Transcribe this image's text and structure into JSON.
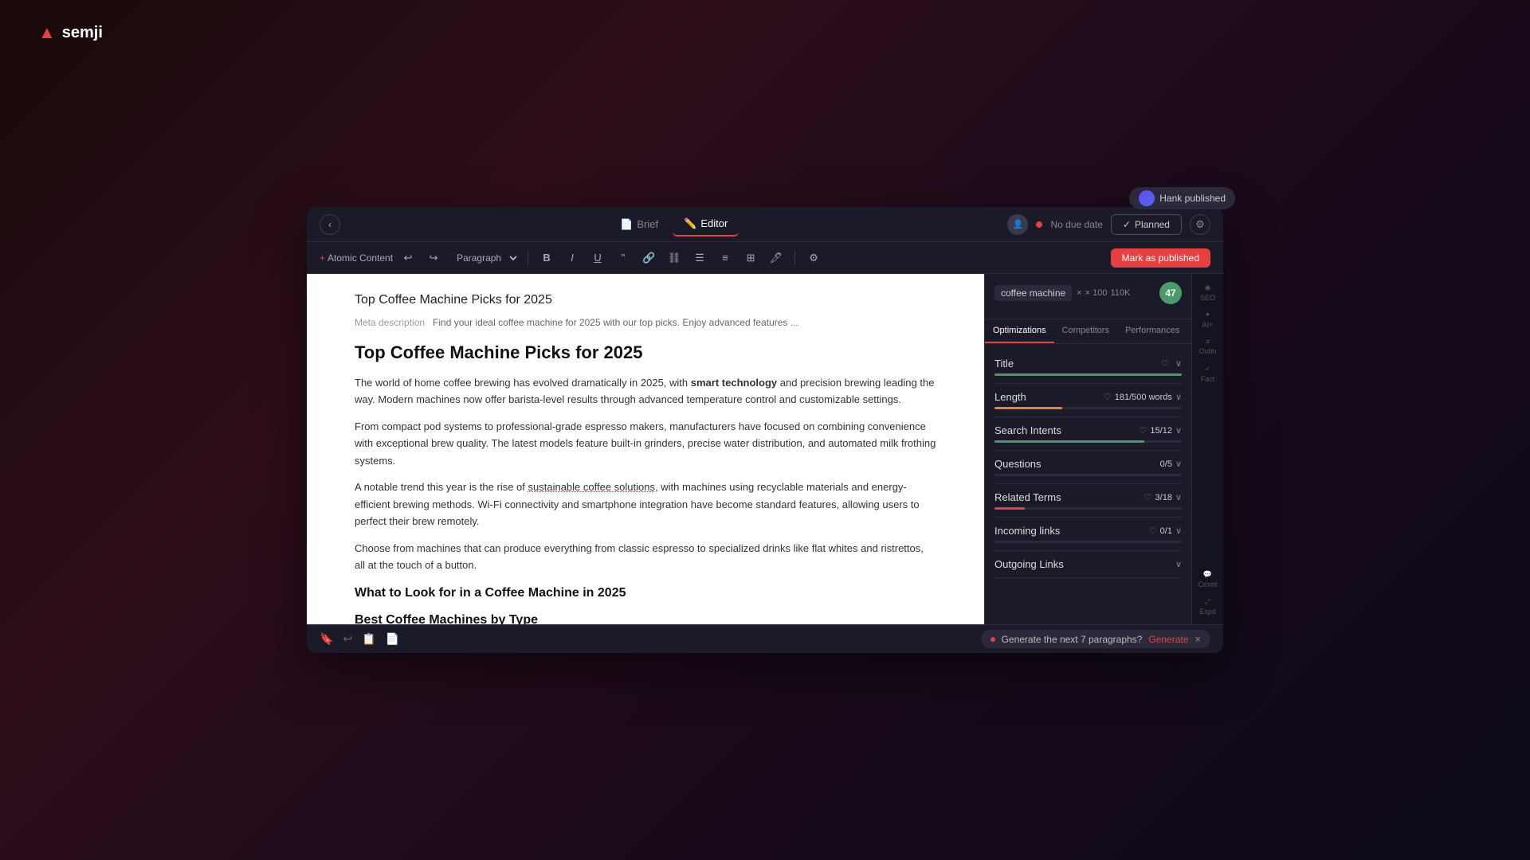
{
  "app": {
    "name": "semji",
    "logo_symbol": "▲"
  },
  "hank_badge": {
    "text": "Hank published"
  },
  "top_bar": {
    "back_label": "‹",
    "tabs": [
      {
        "id": "brief",
        "label": "Brief",
        "icon": "📄",
        "active": false
      },
      {
        "id": "editor",
        "label": "Editor",
        "icon": "✏️",
        "active": true
      }
    ],
    "no_due_date": "No due date",
    "planned_label": "Planned",
    "planned_check": "✓"
  },
  "toolbar": {
    "atomic_content_label": "Atomic Content",
    "paragraph_label": "Paragraph",
    "mark_published_label": "Mark as published",
    "buttons": [
      "B",
      "I",
      "U",
      "\"",
      "🔗",
      "≡",
      "≡",
      "⊞",
      "🖊"
    ]
  },
  "editor": {
    "doc_title": "Top Coffee Machine Picks for 2025",
    "meta_label": "Meta description",
    "meta_text": "Find your ideal coffee machine for 2025 with our top picks. Enjoy advanced features ...",
    "article_title": "Top Coffee Machine Picks for 2025",
    "paragraphs": [
      "The world of home coffee brewing has evolved dramatically in 2025, with smart technology and precision brewing leading the way. Modern machines now offer barista-level results through advanced temperature control and customizable settings.",
      "From compact pod systems to professional-grade espresso makers, manufacturers have focused on combining convenience with exceptional brew quality. The latest models feature built-in grinders, precise water distribution, and automated milk frothing systems.",
      "A notable trend this year is the rise of sustainable coffee solutions, with machines using recyclable materials and energy-efficient brewing methods. Wi-Fi connectivity and smartphone integration have become standard features, allowing users to perfect their brew remotely.",
      "Choose from machines that can produce everything from classic espresso to specialized drinks like flat whites and ristrettos, all at the touch of a button."
    ],
    "section1": "What to Look for in a Coffee Machine in 2025",
    "section2": "Best Coffee Machines by Type"
  },
  "sidebar": {
    "keyword": "coffee machine",
    "keyword_meta1": "× 100",
    "keyword_meta2": "110K",
    "score": "47",
    "tabs": [
      {
        "id": "optimizations",
        "label": "Optimizations",
        "active": true
      },
      {
        "id": "competitors",
        "label": "Competitors",
        "active": false
      },
      {
        "id": "performances",
        "label": "Performances",
        "active": false
      }
    ],
    "optimization_items": [
      {
        "id": "title",
        "label": "Title",
        "score": "♡",
        "count": "",
        "progress": 100,
        "color": "green",
        "chevron": "∨"
      },
      {
        "id": "length",
        "label": "Length",
        "score": "♡",
        "count": "181/500 words",
        "progress": 36,
        "color": "orange",
        "chevron": "∨"
      },
      {
        "id": "search-intents",
        "label": "Search Intents",
        "score": "♡",
        "count": "15/12",
        "progress": 80,
        "color": "green",
        "chevron": "∨"
      },
      {
        "id": "questions",
        "label": "Questions",
        "score": "",
        "count": "0/5",
        "progress": 0,
        "color": "red",
        "chevron": "∨"
      },
      {
        "id": "related-terms",
        "label": "Related Terms",
        "score": "♡",
        "count": "3/18",
        "progress": 16,
        "color": "red",
        "chevron": "∨"
      },
      {
        "id": "incoming-links",
        "label": "Incoming links",
        "score": "♡",
        "count": "0/1",
        "progress": 0,
        "color": "red",
        "chevron": "∨"
      },
      {
        "id": "outgoing-links",
        "label": "Outgoing Links",
        "score": "",
        "count": "",
        "progress": 0,
        "color": "red",
        "chevron": "∨"
      }
    ]
  },
  "right_icons": [
    {
      "id": "seo",
      "label": "SEO",
      "icon": "◉"
    },
    {
      "id": "edit-plus",
      "label": "AI+",
      "icon": "✦"
    },
    {
      "id": "outline",
      "label": "Outline",
      "icon": "≡"
    },
    {
      "id": "fact-checking",
      "label": "Fact",
      "icon": "✓"
    },
    {
      "id": "comments",
      "label": "Cmmt",
      "icon": "💬"
    },
    {
      "id": "expand",
      "label": "Expnd",
      "icon": "⤢"
    }
  ],
  "bottom_bar": {
    "icons": [
      "🔖",
      "↩",
      "📋",
      "📄"
    ],
    "generate_text": "Generate the next 7 paragraphs?",
    "generate_label": "Generate",
    "close_label": "×"
  }
}
